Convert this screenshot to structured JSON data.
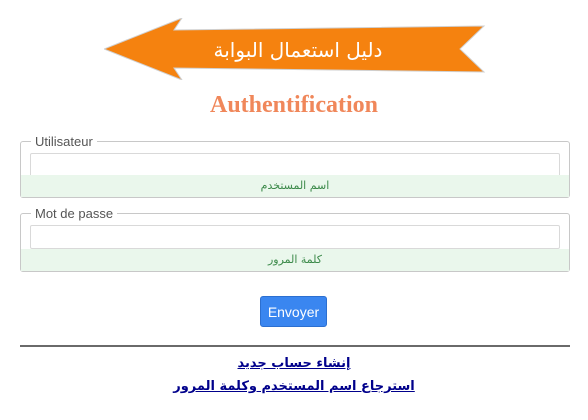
{
  "banner": {
    "text": "دليل استعمال البوابة",
    "color": "#f5820f"
  },
  "title": "Authentification",
  "title_color": "#f0875a",
  "username_field": {
    "legend": "Utilisateur",
    "value": "",
    "placeholder": "",
    "hint": "اسم المستخدم"
  },
  "password_field": {
    "legend": "Mot de passe",
    "value": "",
    "placeholder": "",
    "hint": "كلمة المرور"
  },
  "submit_label": "Envoyer",
  "submit_color": "#3a86f0",
  "links": {
    "create_account": "إنشاء حساب جديد",
    "recover_credentials": "استرجاع اسم المستخدم وكلمة المرور"
  },
  "icons": {
    "banner": "left-arrow-banner"
  }
}
